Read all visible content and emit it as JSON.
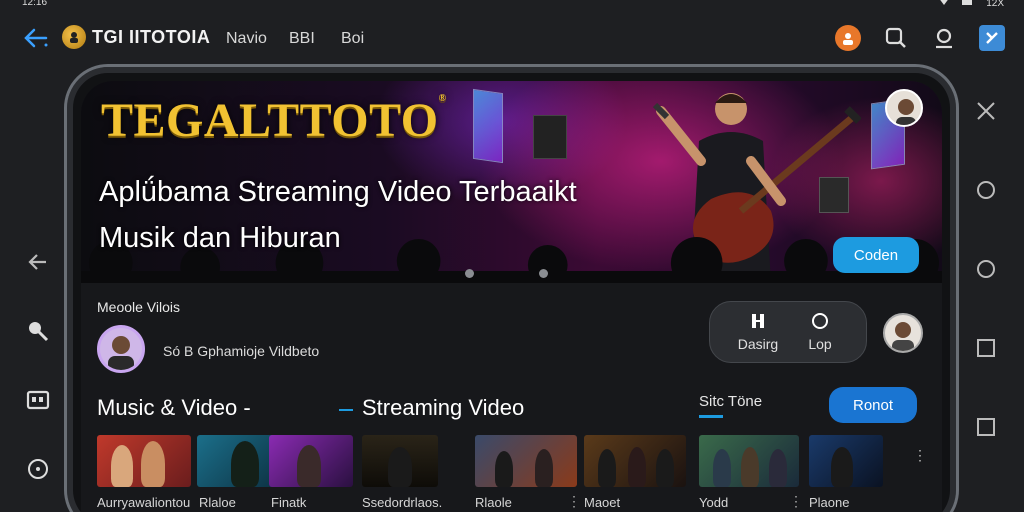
{
  "status": {
    "time": "12:16",
    "right_text": "12X"
  },
  "header": {
    "brand": "TGI IITOTOIA",
    "nav": [
      "Navio",
      "BBI",
      "Boi"
    ]
  },
  "hero": {
    "title": "TEGALTTOTO",
    "trademark": "®",
    "subtitle_line1": "Aplǘbama Streaming Video Terbaaikt",
    "subtitle_line2": "Musik dan Hiburan",
    "button": "Coden"
  },
  "profile": {
    "section_label": "Meoole Vilois",
    "text": "Só  B Gphamioje Vildbeto"
  },
  "toggle": {
    "left_label": "Dasirg",
    "right_label": "Lop"
  },
  "rows": {
    "music_heading": "Music & Video -",
    "streaming_heading": "Streaming Video",
    "side_heading": "Sitc Töne",
    "button": "Ronot"
  },
  "thumbnails": [
    {
      "label": "Aurryawaliontou"
    },
    {
      "label": "Rlaloe"
    },
    {
      "label": "Finatk"
    },
    {
      "label": "Ssedordrlaos."
    },
    {
      "label": "Rlaole"
    },
    {
      "label": "Maoet"
    },
    {
      "label": "Yodd"
    },
    {
      "label": "Plaone"
    }
  ],
  "colors": {
    "accent": "#1d9be0",
    "gold": "#f1c232",
    "bg": "#1e1f22"
  }
}
